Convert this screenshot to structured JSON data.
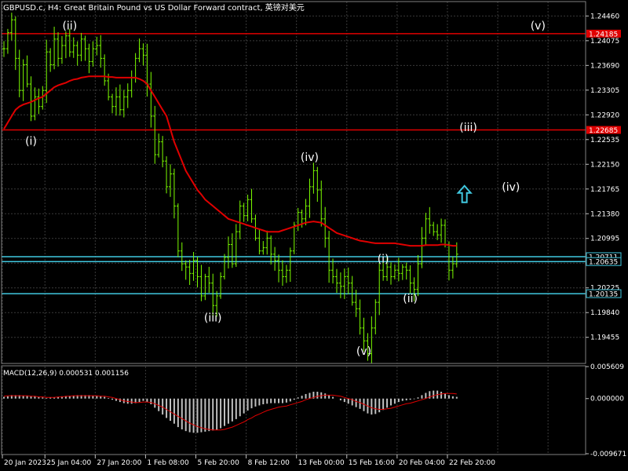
{
  "header": {
    "symbol_title": "GBPUSD.c, H4:  Great Britain Pound vs US Dollar Forward contract, 英镑对美元",
    "macd_title": "MACD(12,26,9) 0.000531 0.001156"
  },
  "colors": {
    "background": "#000000",
    "grid": "#3a3a3a",
    "candle": "#7CFC00",
    "ma": "#E00000",
    "resistance": "#E00000",
    "support": "#40C8E0",
    "histogram": "#C0C0C0",
    "signal": "#E00000",
    "arrow": "#40C8E0"
  },
  "chart_data": [
    {
      "type": "candlestick",
      "name": "price",
      "y_ticks": [
        "1.24460",
        "1.24075",
        "1.23690",
        "1.23305",
        "1.22920",
        "1.22535",
        "1.22150",
        "1.21765",
        "1.21380",
        "1.20995",
        "1.20610",
        "1.20225",
        "1.19840",
        "1.19455"
      ],
      "ylim": [
        1.1906,
        1.2466
      ],
      "x_ticks": [
        "20 Jan 2023",
        "25 Jan 04:00",
        "27 Jan 20:00",
        "1 Feb 08:00",
        "5 Feb 20:00",
        "8 Feb 12:00",
        "13 Feb 00:00",
        "15 Feb 16:00",
        "20 Feb 04:00",
        "22 Feb 20:00"
      ],
      "x_tick_index": [
        0,
        11,
        24,
        37,
        50,
        63,
        76,
        89,
        102,
        115
      ],
      "closes": [
        1.2395,
        1.242,
        1.244,
        1.238,
        1.233,
        1.237,
        1.234,
        1.229,
        1.232,
        1.2305,
        1.233,
        1.239,
        1.237,
        1.241,
        1.238,
        1.24,
        1.2415,
        1.239,
        1.24,
        1.2385,
        1.241,
        1.2395,
        1.2375,
        1.2395,
        1.24,
        1.238,
        1.2345,
        1.232,
        1.2305,
        1.232,
        1.23,
        1.232,
        1.233,
        1.235,
        1.238,
        1.2395,
        1.2385,
        1.234,
        1.229,
        1.223,
        1.225,
        1.222,
        1.218,
        1.22,
        1.215,
        1.208,
        1.206,
        1.2055,
        1.2045,
        1.2065,
        1.204,
        1.201,
        1.204,
        1.203,
        1.1995,
        1.201,
        1.204,
        1.207,
        1.209,
        1.206,
        1.211,
        1.215,
        1.2135,
        1.216,
        1.213,
        1.21,
        1.208,
        1.2085,
        1.21,
        1.2075,
        1.2065,
        1.205,
        1.204,
        1.205,
        1.208,
        1.212,
        1.214,
        1.213,
        1.215,
        1.218,
        1.2205,
        1.2175,
        1.213,
        1.21,
        1.205,
        1.204,
        1.203,
        1.2025,
        1.204,
        1.203,
        1.2,
        1.199,
        1.196,
        1.194,
        1.192,
        1.196,
        1.2,
        1.205,
        1.204,
        1.2055,
        1.204,
        1.205,
        1.2045,
        1.2055,
        1.205,
        1.203,
        1.202,
        1.206,
        1.21,
        1.213,
        1.212,
        1.211,
        1.2105,
        1.212,
        1.209,
        1.205,
        1.206,
        1.2075
      ],
      "ma": [
        1.227,
        1.228,
        1.229,
        1.23,
        1.2305,
        1.2308,
        1.231,
        1.2312,
        1.2315,
        1.2318,
        1.232,
        1.2325,
        1.233,
        1.2335,
        1.2338,
        1.234,
        1.2342,
        1.2345,
        1.2347,
        1.2348,
        1.235,
        1.2351,
        1.2352,
        1.2352,
        1.2352,
        1.2352,
        1.2352,
        1.2351,
        1.2351,
        1.235,
        1.235,
        1.235,
        1.235,
        1.235,
        1.235,
        1.2348,
        1.2345,
        1.234,
        1.233,
        1.232,
        1.231,
        1.23,
        1.229,
        1.227,
        1.225,
        1.2235,
        1.222,
        1.2205,
        1.2195,
        1.2185,
        1.2175,
        1.2168,
        1.216,
        1.2155,
        1.215,
        1.2145,
        1.214,
        1.2135,
        1.213,
        1.2128,
        1.2126,
        1.2124,
        1.2122,
        1.212,
        1.2118,
        1.2116,
        1.2114,
        1.2112,
        1.211,
        1.211,
        1.211,
        1.211,
        1.2112,
        1.2114,
        1.2116,
        1.2118,
        1.212,
        1.2122,
        1.2124,
        1.2125,
        1.2126,
        1.2125,
        1.2124,
        1.212,
        1.2116,
        1.2112,
        1.2108,
        1.2106,
        1.2104,
        1.2102,
        1.21,
        1.2098,
        1.2096,
        1.2095,
        1.2094,
        1.2093,
        1.2092,
        1.2092,
        1.2092,
        1.2092,
        1.2092,
        1.2092,
        1.2091,
        1.209,
        1.2089,
        1.2088,
        1.2088,
        1.2088,
        1.2088,
        1.2089,
        1.2089,
        1.2089,
        1.2089,
        1.209,
        1.209,
        1.2089,
        1.2088,
        1.2088
      ],
      "levels": [
        {
          "value": 1.24185,
          "label": "1.24185",
          "kind": "resistance"
        },
        {
          "value": 1.22685,
          "label": "1.22685",
          "kind": "resistance"
        },
        {
          "value": 1.20711,
          "label": "1.20711",
          "kind": "support"
        },
        {
          "value": 1.20635,
          "label": "1.20635",
          "kind": "support"
        },
        {
          "value": 1.20135,
          "label": "1.20135",
          "kind": "support"
        }
      ],
      "wave_labels": [
        {
          "text": "(ii)",
          "bar": 17,
          "price": 1.2425
        },
        {
          "text": "(i)",
          "bar": 7,
          "price": 1.2245
        },
        {
          "text": "(iv)",
          "bar": 79,
          "price": 1.222
        },
        {
          "text": "(iii)",
          "bar": 54,
          "price": 1.197
        },
        {
          "text": "(v)",
          "bar": 93,
          "price": 1.1918
        },
        {
          "text": "(i)",
          "bar": 98,
          "price": 1.2062
        },
        {
          "text": "(ii)",
          "bar": 105,
          "price": 1.2
        },
        {
          "text": "(v)",
          "bar": 138,
          "price": 1.2425
        },
        {
          "text": "(iii)",
          "bar": 120,
          "price": 1.2267
        },
        {
          "text": "(iv)",
          "bar": 131,
          "price": 1.2174
        }
      ],
      "arrow": {
        "direction": "up",
        "bar": 119,
        "price": 1.2168
      }
    },
    {
      "type": "bar",
      "name": "MACD",
      "y_ticks": [
        "0.005609",
        "0.000000",
        "-0.009671"
      ],
      "ylim": [
        -0.009671,
        0.005609
      ],
      "histogram": [
        0.0003,
        0.0004,
        0.0006,
        0.0006,
        0.0006,
        0.0005,
        0.0005,
        0.0004,
        0.0004,
        0.0003,
        0.0002,
        0.0001,
        0.0002,
        0.0002,
        0.0003,
        0.0004,
        0.0004,
        0.0005,
        0.0005,
        0.0006,
        0.0006,
        0.0006,
        0.0006,
        0.0005,
        0.0005,
        0.0004,
        0.0003,
        0.0001,
        -0.0002,
        -0.0004,
        -0.0006,
        -0.0008,
        -0.0009,
        -0.0009,
        -0.0008,
        -0.0006,
        -0.0004,
        -0.0006,
        -0.001,
        -0.0016,
        -0.0022,
        -0.0028,
        -0.0034,
        -0.0039,
        -0.0044,
        -0.005,
        -0.0054,
        -0.0057,
        -0.0059,
        -0.006,
        -0.006,
        -0.0059,
        -0.0058,
        -0.0057,
        -0.0056,
        -0.0055,
        -0.0052,
        -0.0048,
        -0.0044,
        -0.004,
        -0.0036,
        -0.0031,
        -0.0026,
        -0.0021,
        -0.0017,
        -0.0014,
        -0.0012,
        -0.001,
        -0.0009,
        -0.0008,
        -0.0008,
        -0.0008,
        -0.0008,
        -0.0007,
        -0.0005,
        -0.0002,
        0.0002,
        0.0005,
        0.0008,
        0.001,
        0.0012,
        0.0012,
        0.0011,
        0.0009,
        0.0006,
        0.0003,
        0.0,
        -0.0003,
        -0.0006,
        -0.0009,
        -0.0012,
        -0.0015,
        -0.0018,
        -0.0022,
        -0.0026,
        -0.0028,
        -0.0027,
        -0.0024,
        -0.002,
        -0.0016,
        -0.0012,
        -0.0009,
        -0.0006,
        -0.0004,
        -0.0003,
        -0.0002,
        -0.0001,
        0.0002,
        0.0006,
        0.001,
        0.0013,
        0.0014,
        0.0014,
        0.0012,
        0.0009,
        0.0006,
        0.0004,
        0.0003
      ],
      "signal": [
        0.0004,
        0.0005,
        0.0005,
        0.0005,
        0.0005,
        0.0005,
        0.0005,
        0.0004,
        0.0004,
        0.0003,
        0.0003,
        0.0002,
        0.0002,
        0.0002,
        0.0003,
        0.0003,
        0.0004,
        0.0004,
        0.0005,
        0.0005,
        0.0005,
        0.0005,
        0.0005,
        0.0005,
        0.0005,
        0.0004,
        0.0004,
        0.0003,
        0.0002,
        0.0,
        -0.0002,
        -0.0004,
        -0.0005,
        -0.0006,
        -0.0007,
        -0.0007,
        -0.0006,
        -0.0006,
        -0.0007,
        -0.0009,
        -0.0012,
        -0.0015,
        -0.0019,
        -0.0023,
        -0.0027,
        -0.0031,
        -0.0035,
        -0.0039,
        -0.0043,
        -0.0046,
        -0.0049,
        -0.0051,
        -0.0053,
        -0.0054,
        -0.0055,
        -0.0055,
        -0.0055,
        -0.0054,
        -0.0052,
        -0.005,
        -0.0047,
        -0.0044,
        -0.0041,
        -0.0037,
        -0.0034,
        -0.003,
        -0.0027,
        -0.0024,
        -0.0021,
        -0.0019,
        -0.0017,
        -0.0015,
        -0.0014,
        -0.0013,
        -0.0011,
        -0.0009,
        -0.0007,
        -0.0005,
        -0.0002,
        0.0,
        0.0002,
        0.0004,
        0.0005,
        0.0006,
        0.0006,
        0.0006,
        0.0005,
        0.0004,
        0.0002,
        0.0,
        -0.0002,
        -0.0005,
        -0.0007,
        -0.001,
        -0.0013,
        -0.0016,
        -0.0018,
        -0.0019,
        -0.0019,
        -0.0018,
        -0.0017,
        -0.0015,
        -0.0013,
        -0.0011,
        -0.0009,
        -0.0008,
        -0.0006,
        -0.0004,
        -0.0002,
        0.0,
        0.0003,
        0.0005,
        0.0007,
        0.0008,
        0.0009,
        0.0009,
        0.0009,
        0.0008
      ]
    }
  ]
}
